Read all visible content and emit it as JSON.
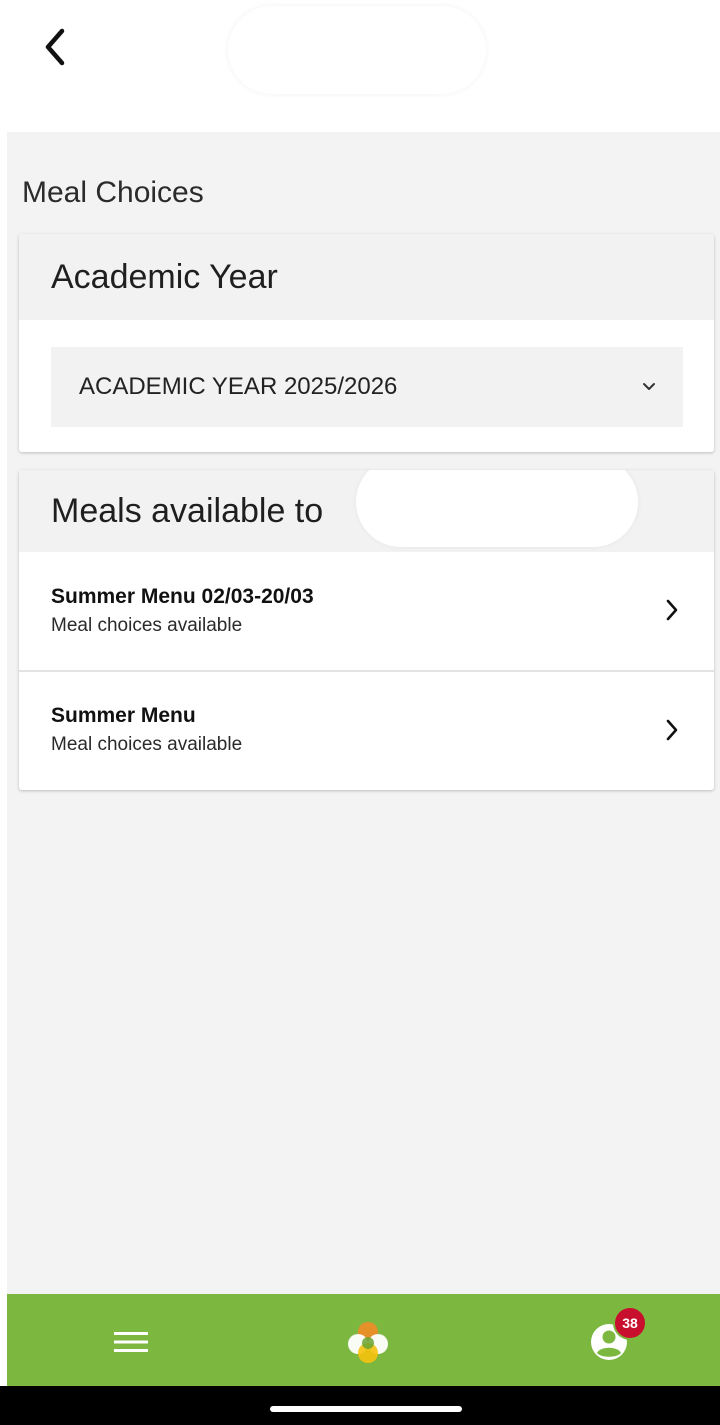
{
  "header": {
    "back_icon": "chevron-left-icon"
  },
  "page": {
    "section_title": "Meal Choices"
  },
  "academic_year_card": {
    "title": "Academic Year",
    "selected_value": "ACADEMIC YEAR 2025/2026",
    "dropdown_icon": "chevron-down-icon"
  },
  "meals_card": {
    "title": "Meals available to",
    "items": [
      {
        "title": "Summer Menu 02/03-20/03",
        "subtitle": "Meal choices available"
      },
      {
        "title": "Summer Menu",
        "subtitle": "Meal choices available"
      }
    ]
  },
  "bottom_nav": {
    "menu_icon": "hamburger-menu-icon",
    "home_icon": "app-logo-icon",
    "profile_icon": "profile-icon",
    "notification_count": "38"
  },
  "colors": {
    "nav_green": "#7cb73f",
    "badge_red": "#c8102e",
    "background": "#f3f3f3"
  }
}
